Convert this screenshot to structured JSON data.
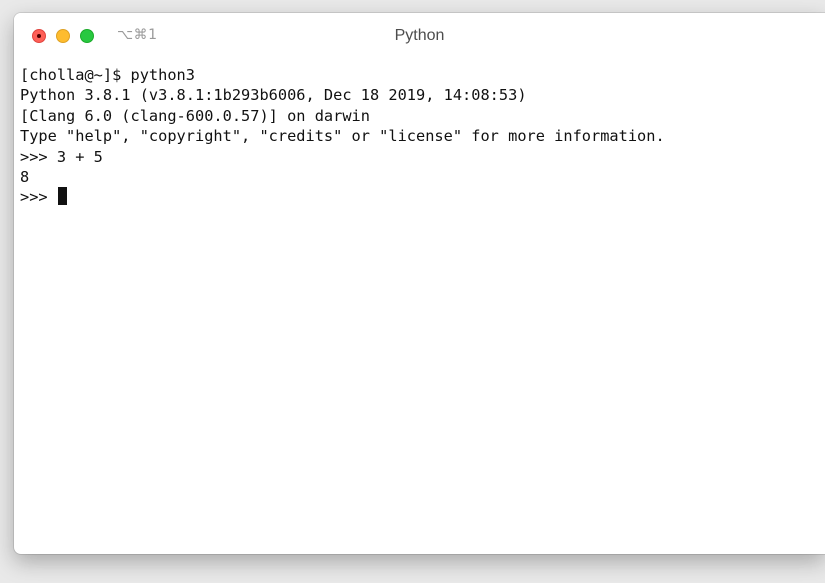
{
  "window": {
    "title": "Python",
    "shortcut": "⌥⌘1",
    "traffic_lights": {
      "close_color": "#fe5f57",
      "minimize_color": "#febc2e",
      "zoom_color": "#28c840"
    }
  },
  "terminal": {
    "lines": [
      "[cholla@~]$ python3",
      "Python 3.8.1 (v3.8.1:1b293b6006, Dec 18 2019, 14:08:53)",
      "[Clang 6.0 (clang-600.0.57)] on darwin",
      "Type \"help\", \"copyright\", \"credits\" or \"license\" for more information.",
      ">>> 3 + 5",
      "8"
    ],
    "prompt": ">>> "
  }
}
